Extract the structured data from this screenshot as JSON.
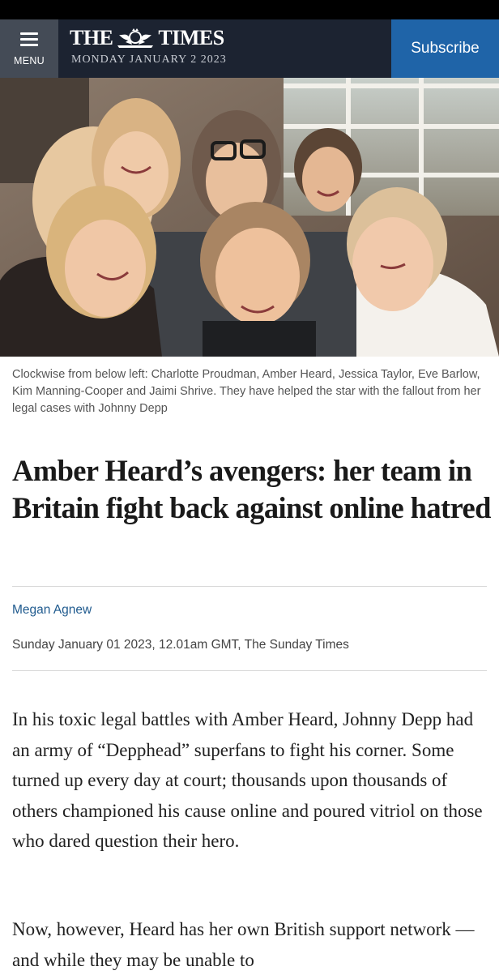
{
  "header": {
    "menu_label": "MENU",
    "logo_left": "THE",
    "logo_right": "TIMES",
    "date": "MONDAY JANUARY 2 2023",
    "subscribe_label": "Subscribe"
  },
  "article": {
    "caption": "Clockwise from below left: Charlotte Proudman, Amber Heard, Jessica Taylor, Eve Barlow, Kim Manning-Cooper and Jaimi Shrive. They have helped the star with the fallout from her legal cases with Johnny Depp",
    "headline": "Amber Heard’s avengers: her team in Britain fight back against online hatred",
    "author": "Megan Agnew",
    "published": "Sunday January 01 2023, 12.01am GMT, The Sunday Times",
    "paragraphs": [
      "In his toxic legal battles with Amber Heard, Johnny Depp had an army of “Depphead” superfans to fight his corner. Some turned up every day at court; thousands upon thousands of others championed his cause online and poured vitriol on those who dared question their hero.",
      "Now, however, Heard has her own British support network — and while they may be unable to"
    ]
  }
}
